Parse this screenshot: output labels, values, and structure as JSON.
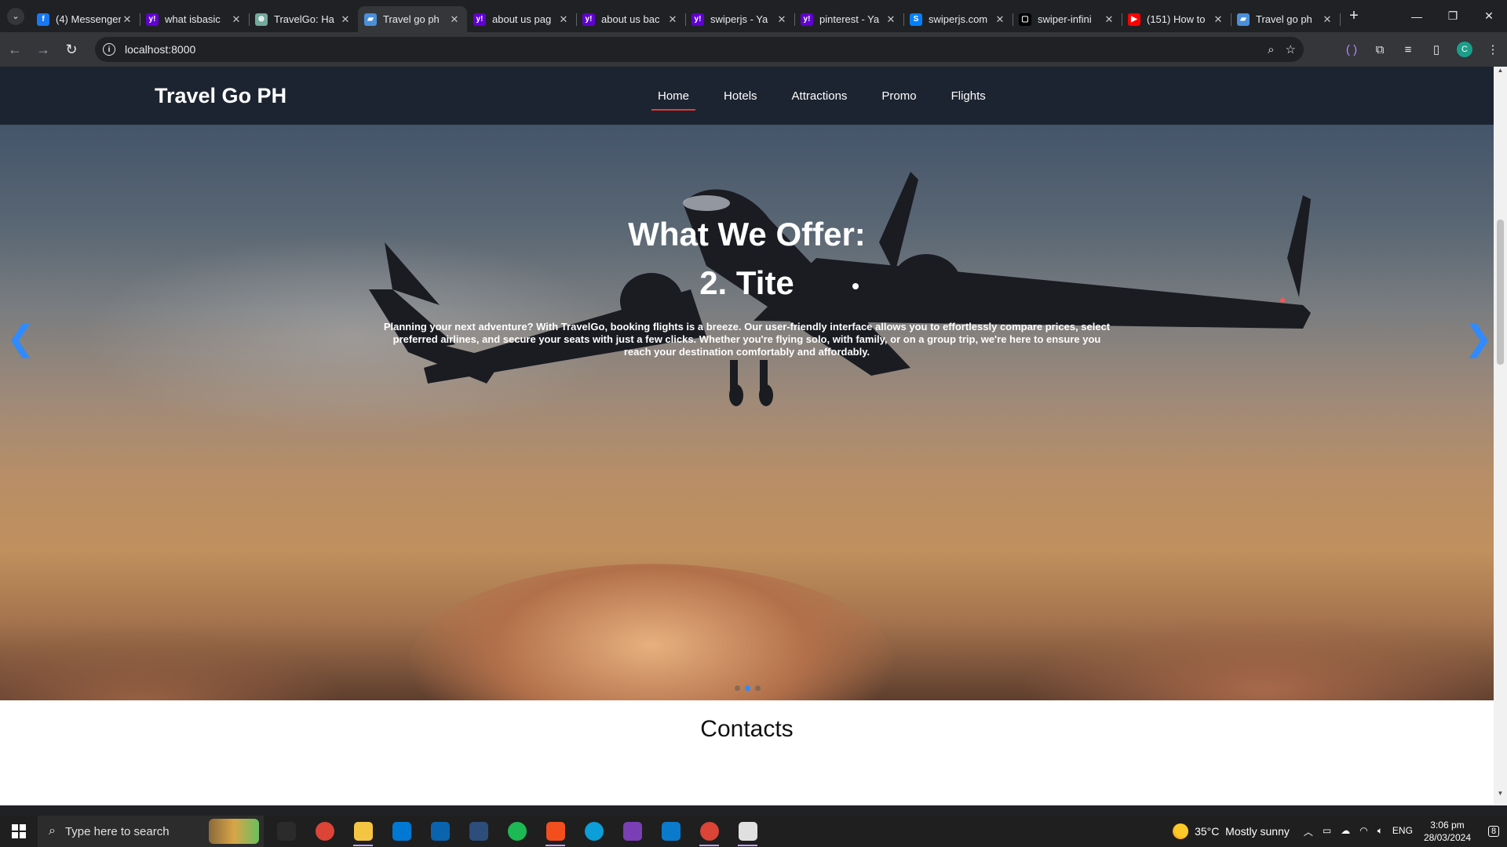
{
  "browser": {
    "tabs": [
      {
        "title": "(4) Messenger",
        "favicon_color": "#1877f2",
        "favicon_glyph": "f",
        "active": false
      },
      {
        "title": "what isbasic",
        "favicon_color": "#6001d2",
        "favicon_glyph": "y!",
        "active": false
      },
      {
        "title": "TravelGo: Ha",
        "favicon_color": "#74aa9c",
        "favicon_glyph": "⊛",
        "active": false
      },
      {
        "title": "Travel go ph",
        "favicon_color": "#4a90d9",
        "favicon_glyph": "▰",
        "active": true
      },
      {
        "title": "about us pag",
        "favicon_color": "#6001d2",
        "favicon_glyph": "y!",
        "active": false
      },
      {
        "title": "about us bac",
        "favicon_color": "#6001d2",
        "favicon_glyph": "y!",
        "active": false
      },
      {
        "title": "swiperjs - Ya",
        "favicon_color": "#6001d2",
        "favicon_glyph": "y!",
        "active": false
      },
      {
        "title": "pinterest - Ya",
        "favicon_color": "#6001d2",
        "favicon_glyph": "y!",
        "active": false
      },
      {
        "title": "swiperjs.com",
        "favicon_color": "#0080ff",
        "favicon_glyph": "S",
        "active": false
      },
      {
        "title": "swiper-infini",
        "favicon_color": "#000000",
        "favicon_glyph": "▢",
        "active": false
      },
      {
        "title": "(151) How to",
        "favicon_color": "#ff0000",
        "favicon_glyph": "▶",
        "active": false
      },
      {
        "title": "Travel go ph",
        "favicon_color": "#4a90d9",
        "favicon_glyph": "▰",
        "active": false
      }
    ],
    "url": "localhost:8000",
    "profile_initial": "C",
    "icons": {
      "back": "back-arrow-icon",
      "forward": "forward-arrow-icon",
      "reload": "reload-icon",
      "zoom": "zoom-icon",
      "star": "bookmark-star-icon"
    }
  },
  "site": {
    "logo": "Travel Go PH",
    "nav": [
      {
        "label": "Home",
        "active": true
      },
      {
        "label": "Hotels",
        "active": false
      },
      {
        "label": "Attractions",
        "active": false
      },
      {
        "label": "Promo",
        "active": false
      },
      {
        "label": "Flights",
        "active": false
      }
    ],
    "hero": {
      "title": "What We Offer:",
      "subtitle": "2. Tite",
      "description": "Planning your next adventure? With TravelGo, booking flights is a breeze. Our user-friendly interface allows you to effortlessly compare prices, select preferred airlines, and secure your seats with just a few clicks. Whether you're flying solo, with family, or on a group trip, we're here to ensure you reach your destination comfortably and affordably.",
      "slide_count": 3,
      "active_slide": 2,
      "arrow_color": "#2f8bff"
    },
    "contacts_heading": "Contacts"
  },
  "taskbar": {
    "search_placeholder": "Type here to search",
    "apps": [
      {
        "name": "task-view-icon",
        "color": "#2b2b2b",
        "running": false
      },
      {
        "name": "chrome-icon",
        "color": "#db4437",
        "running": false
      },
      {
        "name": "file-explorer-icon",
        "color": "#f4c542",
        "running": true
      },
      {
        "name": "microsoft-store-icon",
        "color": "#0078d4",
        "running": false
      },
      {
        "name": "mail-icon",
        "color": "#0a64ad",
        "running": false
      },
      {
        "name": "ssms-icon",
        "color": "#2d4d7a",
        "running": false
      },
      {
        "name": "spotify-icon",
        "color": "#1db954",
        "running": false
      },
      {
        "name": "figma-icon",
        "color": "#f24e1e",
        "running": true
      },
      {
        "name": "edge-icon",
        "color": "#0c9ed8",
        "running": false
      },
      {
        "name": "visual-studio-icon",
        "color": "#7b3fb5",
        "running": false
      },
      {
        "name": "vscode-icon",
        "color": "#0a7acc",
        "running": false
      },
      {
        "name": "chrome-active-icon",
        "color": "#db4437",
        "running": true
      },
      {
        "name": "settings-icon",
        "color": "#e0e0e0",
        "running": true
      }
    ],
    "weather": "35°C  Mostly sunny",
    "language": "ENG",
    "time": "3:06 pm",
    "date": "28/03/2024",
    "notification_count": "8"
  }
}
